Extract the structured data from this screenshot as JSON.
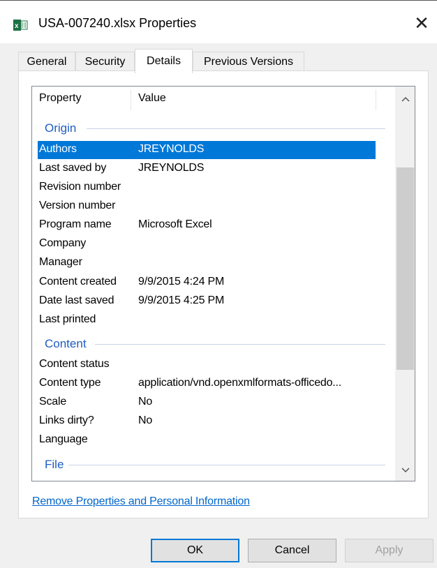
{
  "window": {
    "title": "USA-007240.xlsx Properties",
    "close_glyph": "✕",
    "icon": "excel-file-icon"
  },
  "tabs": [
    {
      "label": "General",
      "active": false
    },
    {
      "label": "Security",
      "active": false
    },
    {
      "label": "Details",
      "active": true
    },
    {
      "label": "Previous Versions",
      "active": false
    }
  ],
  "list": {
    "columns": {
      "property": "Property",
      "value": "Value"
    },
    "groups": {
      "origin": "Origin",
      "content": "Content",
      "file": "File"
    },
    "origin_rows": [
      {
        "name": "Authors",
        "value": "JREYNOLDS",
        "selected": true
      },
      {
        "name": "Last saved by",
        "value": "JREYNOLDS"
      },
      {
        "name": "Revision number",
        "value": ""
      },
      {
        "name": "Version number",
        "value": ""
      },
      {
        "name": "Program name",
        "value": "Microsoft Excel"
      },
      {
        "name": "Company",
        "value": ""
      },
      {
        "name": "Manager",
        "value": ""
      },
      {
        "name": "Content created",
        "value": "9/9/2015 4:24 PM"
      },
      {
        "name": "Date last saved",
        "value": "9/9/2015 4:25 PM"
      },
      {
        "name": "Last printed",
        "value": ""
      }
    ],
    "content_rows": [
      {
        "name": "Content status",
        "value": ""
      },
      {
        "name": "Content type",
        "value": "application/vnd.openxmlformats-officedo..."
      },
      {
        "name": "Scale",
        "value": "No"
      },
      {
        "name": "Links dirty?",
        "value": "No"
      },
      {
        "name": "Language",
        "value": ""
      }
    ],
    "scroll_up_glyph": "︿",
    "scroll_down_glyph": "﹀"
  },
  "link": {
    "label": "Remove Properties and Personal Information"
  },
  "buttons": {
    "ok": "OK",
    "cancel": "Cancel",
    "apply": "Apply"
  },
  "colors": {
    "selection": "#0078d7",
    "group_header": "#1e5cc4",
    "link": "#0066cc"
  }
}
